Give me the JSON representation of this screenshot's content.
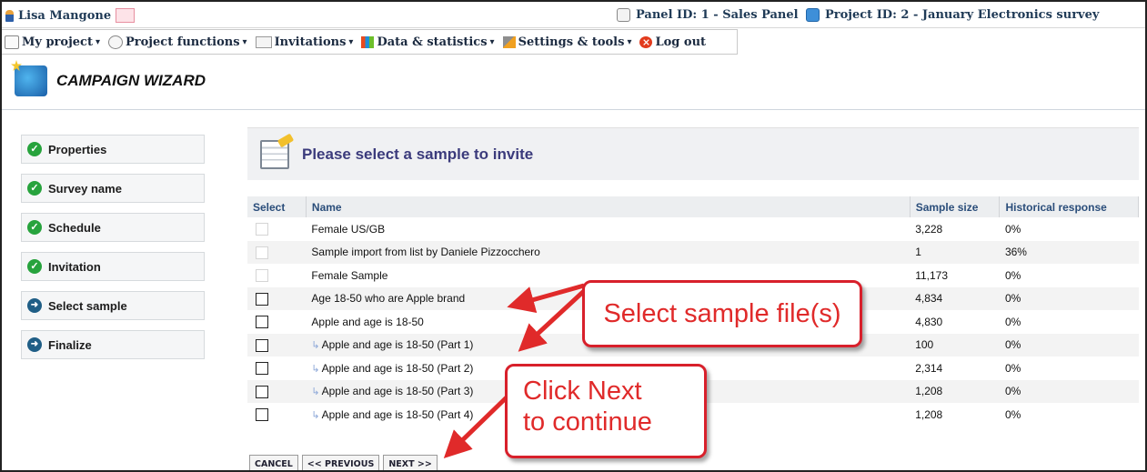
{
  "topbar": {
    "user": "Lisa Mangone",
    "panel_id": "Panel ID: 1 - Sales Panel",
    "project_id": "Project ID: 2 - January Electronics survey"
  },
  "menu": [
    {
      "label": "My project",
      "icon": "home-icon",
      "caret": "▾"
    },
    {
      "label": "Project functions",
      "icon": "functions-icon",
      "caret": "▾"
    },
    {
      "label": "Invitations",
      "icon": "envelope-icon",
      "caret": "▾"
    },
    {
      "label": "Data & statistics",
      "icon": "chart-icon",
      "caret": "▾"
    },
    {
      "label": "Settings & tools",
      "icon": "tools-icon",
      "caret": "▾"
    },
    {
      "label": "Log out",
      "icon": "logout-icon",
      "caret": ""
    }
  ],
  "wizard": {
    "title": "CAMPAIGN WIZARD"
  },
  "steps": [
    {
      "label": "Properties",
      "status": "done"
    },
    {
      "label": "Survey name",
      "status": "done"
    },
    {
      "label": "Schedule",
      "status": "done"
    },
    {
      "label": "Invitation",
      "status": "done"
    },
    {
      "label": "Select sample",
      "status": "current"
    },
    {
      "label": "Finalize",
      "status": "pending"
    }
  ],
  "sample": {
    "title": "Please select a sample to invite",
    "columns": {
      "select": "Select",
      "name": "Name",
      "size": "Sample size",
      "hist": "Historical response"
    },
    "rows": [
      {
        "name": "Female US/GB",
        "size": "3,228",
        "hist": "0%",
        "enabled": false,
        "sub": false
      },
      {
        "name": "Sample import from list by Daniele Pizzocchero",
        "size": "1",
        "hist": "36%",
        "enabled": false,
        "sub": false
      },
      {
        "name": "Female Sample",
        "size": "11,173",
        "hist": "0%",
        "enabled": false,
        "sub": false
      },
      {
        "name": "Age 18-50 who are Apple brand",
        "size": "4,834",
        "hist": "0%",
        "enabled": true,
        "sub": false
      },
      {
        "name": "Apple and age is 18-50",
        "size": "4,830",
        "hist": "0%",
        "enabled": true,
        "sub": false
      },
      {
        "name": "Apple and age is 18-50 (Part 1)",
        "size": "100",
        "hist": "0%",
        "enabled": true,
        "sub": true
      },
      {
        "name": "Apple and age is 18-50 (Part 2)",
        "size": "2,314",
        "hist": "0%",
        "enabled": true,
        "sub": true
      },
      {
        "name": "Apple and age is 18-50 (Part 3)",
        "size": "1,208",
        "hist": "0%",
        "enabled": true,
        "sub": true
      },
      {
        "name": "Apple and age is 18-50 (Part 4)",
        "size": "1,208",
        "hist": "0%",
        "enabled": true,
        "sub": true
      }
    ]
  },
  "buttons": {
    "cancel": "CANCEL",
    "previous": "<< PREVIOUS",
    "next": "NEXT >>"
  },
  "callouts": {
    "select": "Select sample file(s)",
    "next_line1": "Click Next",
    "next_line2": "to continue"
  },
  "colors": {
    "callout_red": "#e02a2a",
    "done_green": "#27a33d",
    "current_blue": "#1f5e86",
    "title_purple": "#3b3b7c"
  }
}
